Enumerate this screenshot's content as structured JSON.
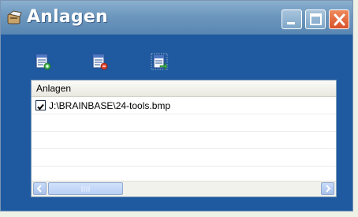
{
  "window": {
    "title": "Anlagen"
  },
  "titlebar": {
    "icon": "attachment-app-icon",
    "buttons": [
      "minimize-icon",
      "maximize-icon",
      "close-icon"
    ]
  },
  "toolbar": {
    "icons": [
      "add-attachment-icon",
      "remove-attachment-icon",
      "open-attachment-icon"
    ]
  },
  "list": {
    "header": "Anlagen",
    "items": [
      {
        "checked": true,
        "label": "J:\\BRAINBASE\\24-tools.bmp"
      }
    ]
  },
  "colors": {
    "window_bg": "#1f5aa0",
    "titlebar": "#6d97bd",
    "close_button": "#d9522a"
  }
}
